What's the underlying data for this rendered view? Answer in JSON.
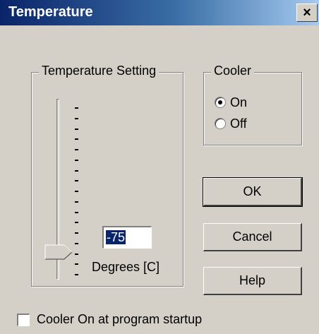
{
  "window": {
    "title": "Temperature",
    "close_glyph": "×",
    "close_icon": "close-icon"
  },
  "temperature_group": {
    "label": "Temperature Setting",
    "slider_ticks": 17,
    "slider_level_fraction": 0.87,
    "value": "-75",
    "unit_label": "Degrees [C]"
  },
  "cooler_group": {
    "label": "Cooler",
    "options": [
      {
        "label": "On",
        "selected": true
      },
      {
        "label": "Off",
        "selected": false
      }
    ]
  },
  "buttons": {
    "ok": "OK",
    "cancel": "Cancel",
    "help": "Help"
  },
  "startup_checkbox": {
    "label": "Cooler On at program startup",
    "checked": false
  },
  "colors": {
    "face": "#d4d0c8",
    "title_start": "#0a246a",
    "title_end": "#a6caf0",
    "selection": "#0a246a"
  }
}
